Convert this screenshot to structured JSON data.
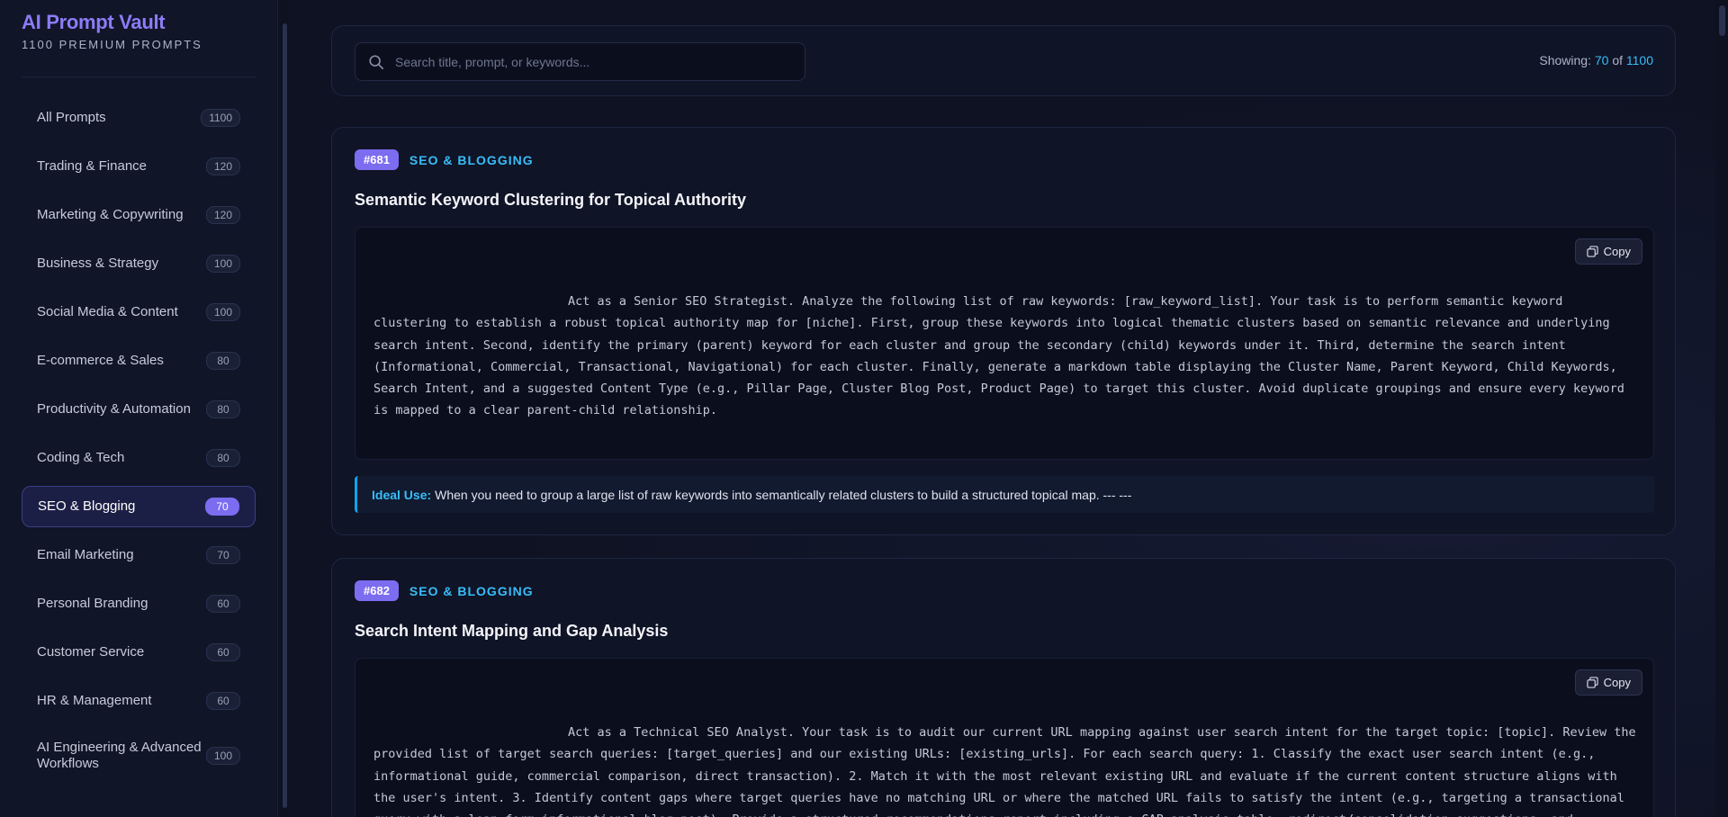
{
  "brand": {
    "title": "AI Prompt Vault",
    "subtitle": "1100 PREMIUM PROMPTS"
  },
  "sidebar": {
    "items": [
      {
        "label": "All Prompts",
        "count": "1100"
      },
      {
        "label": "Trading & Finance",
        "count": "120"
      },
      {
        "label": "Marketing & Copywriting",
        "count": "120"
      },
      {
        "label": "Business & Strategy",
        "count": "100"
      },
      {
        "label": "Social Media & Content",
        "count": "100"
      },
      {
        "label": "E-commerce & Sales",
        "count": "80"
      },
      {
        "label": "Productivity & Automation",
        "count": "80"
      },
      {
        "label": "Coding & Tech",
        "count": "80"
      },
      {
        "label": "SEO & Blogging",
        "count": "70",
        "active": true
      },
      {
        "label": "Email Marketing",
        "count": "70"
      },
      {
        "label": "Personal Branding",
        "count": "60"
      },
      {
        "label": "Customer Service",
        "count": "60"
      },
      {
        "label": "HR & Management",
        "count": "60"
      },
      {
        "label": "AI Engineering & Advanced Workflows",
        "count": "100"
      }
    ]
  },
  "search": {
    "placeholder": "Search title, prompt, or keywords...",
    "value": "",
    "showing_label": "Showing:",
    "showing_count": "70",
    "of_label": "of",
    "total": "1100"
  },
  "cards": [
    {
      "id": "#681",
      "category": "SEO & BLOGGING",
      "title": "Semantic Keyword Clustering for Topical Authority",
      "copy_label": "Copy",
      "prompt": "Act as a Senior SEO Strategist. Analyze the following list of raw keywords: [raw_keyword_list]. Your task is to perform semantic keyword clustering to establish a robust topical authority map for [niche]. First, group these keywords into logical thematic clusters based on semantic relevance and underlying search intent. Second, identify the primary (parent) keyword for each cluster and group the secondary (child) keywords under it. Third, determine the search intent (Informational, Commercial, Transactional, Navigational) for each cluster. Finally, generate a markdown table displaying the Cluster Name, Parent Keyword, Child Keywords, Search Intent, and a suggested Content Type (e.g., Pillar Page, Cluster Blog Post, Product Page) to target this cluster. Avoid duplicate groupings and ensure every keyword is mapped to a clear parent-child relationship.",
      "ideal_label": "Ideal Use:",
      "ideal_text": "When you need to group a large list of raw keywords into semantically related clusters to build a structured topical map. --- ---"
    },
    {
      "id": "#682",
      "category": "SEO & BLOGGING",
      "title": "Search Intent Mapping and Gap Analysis",
      "copy_label": "Copy",
      "prompt": "Act as a Technical SEO Analyst. Your task is to audit our current URL mapping against user search intent for the target topic: [topic]. Review the provided list of target search queries: [target_queries] and our existing URLs: [existing_urls]. For each search query: 1. Classify the exact user search intent (e.g., informational guide, commercial comparison, direct transaction). 2. Match it with the most relevant existing URL and evaluate if the current content structure aligns with the user's intent. 3. Identify content gaps where target queries have no matching URL or where the matched URL fails to satisfy the intent (e.g., targeting a transactional query with a lean-form informational blog post). Provide a structured recommendations report including a GAP analysis table, redirect/consolidation suggestions, and concrete actions."
    }
  ],
  "colors": {
    "accent": "#7c6cf0",
    "link": "#38bdf8",
    "background": "#0e1222"
  }
}
